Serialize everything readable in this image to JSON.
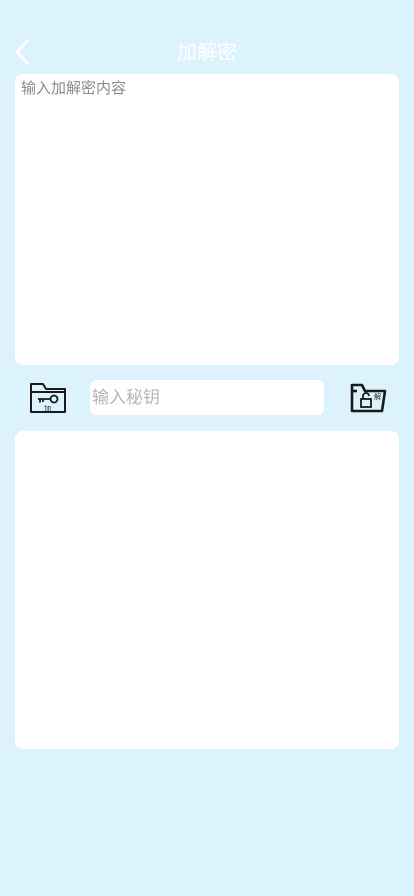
{
  "header": {
    "title": "加解密"
  },
  "content_input": {
    "placeholder": "输入加解密内容",
    "value": ""
  },
  "key_input": {
    "placeholder": "输入秘钥",
    "value": ""
  },
  "encrypt_button": {
    "badge": "加"
  },
  "decrypt_button": {
    "badge": "解"
  },
  "result": {
    "text": ""
  },
  "colors": {
    "background": "#dcf3fd",
    "card": "#ffffff",
    "title": "#ffffff",
    "icon": "#1a1a1a"
  },
  "icons": {
    "back": "chevron-left-icon",
    "encrypt": "folder-key-icon",
    "decrypt": "folder-unlock-icon"
  }
}
